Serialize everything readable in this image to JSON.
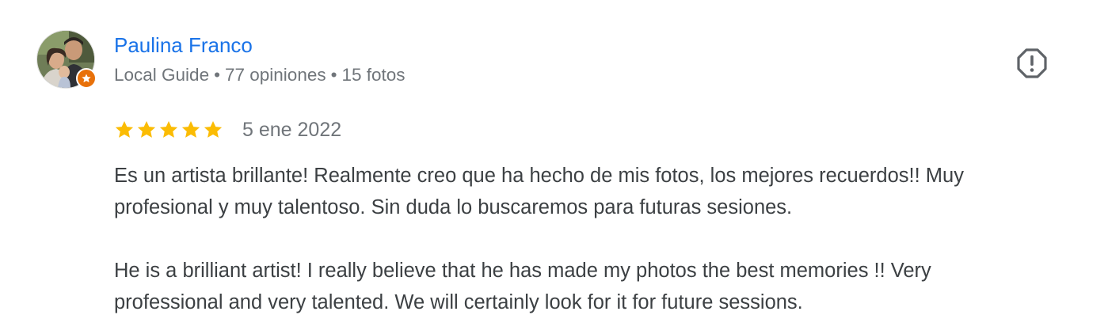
{
  "review": {
    "author_name": "Paulina Franco",
    "author_meta": {
      "badge": "Local Guide",
      "reviews": "77 opiniones",
      "photos": "15 fotos",
      "separator": "•"
    },
    "rating": 5,
    "max_rating": 5,
    "date": "5 ene 2022",
    "text_original": "Es un artista brillante! Realmente creo que ha hecho de mis fotos, los mejores recuerdos!! Muy\nprofesional y muy talentoso. Sin duda lo buscaremos para futuras sesiones.",
    "text_translated": "He is a brilliant artist! I really believe that he has made my photos the best memories !! Very\nprofessional and very talented. We will certainly look for it for future sessions."
  },
  "icons": {
    "avatar": "user-avatar-photo",
    "guide_badge": "local-guide-star-icon",
    "report": "report-flag-icon",
    "star": "star-icon"
  },
  "colors": {
    "author_link": "#1a73e8",
    "meta_text": "#70757a",
    "body_text": "#3c4043",
    "star_filled": "#fbbc04",
    "guide_badge": "#e8710a",
    "report_icon": "#5f6368"
  }
}
